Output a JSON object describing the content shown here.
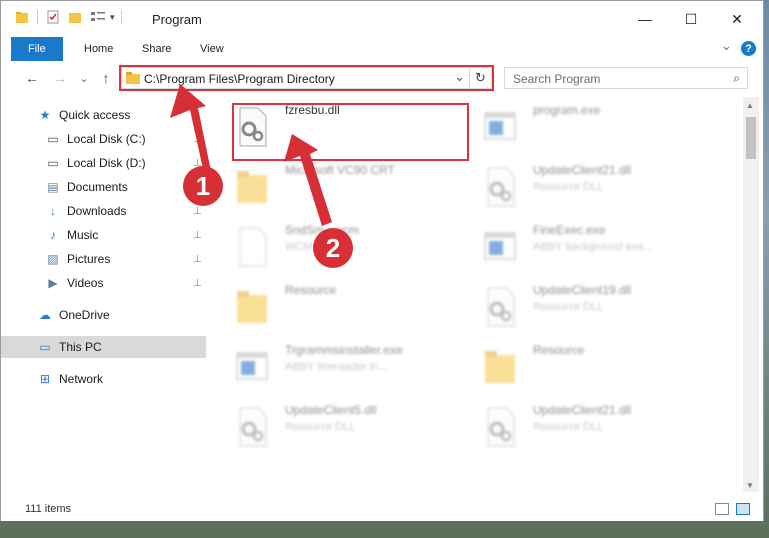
{
  "window": {
    "title": "Program",
    "controls": {
      "minimize": "—",
      "maximize": "☐",
      "close": "✕"
    }
  },
  "ribbon": {
    "tabs": [
      "File",
      "Home",
      "Share",
      "View"
    ],
    "collapse_glyph": "⌄",
    "help_glyph": "?"
  },
  "address": {
    "path": "C:\\Program Files\\Program Directory",
    "dropdown_glyph": "⌄",
    "refresh_glyph": "↻"
  },
  "search": {
    "placeholder": "Search Program",
    "icon_glyph": "⌕"
  },
  "nav": {
    "back": "←",
    "forward": "→",
    "recent": "⌄",
    "up": "↑"
  },
  "sidebar": {
    "items": [
      {
        "label": "Quick access",
        "icon": "star-icon",
        "glyph": "★",
        "color": "#2b7bd3",
        "pinned": false
      },
      {
        "label": "Local Disk (C:)",
        "icon": "drive-icon",
        "glyph": "▭",
        "color": "#555",
        "pinned": true
      },
      {
        "label": "Local Disk (D:)",
        "icon": "drive-icon",
        "glyph": "▭",
        "color": "#555",
        "pinned": true
      },
      {
        "label": "Documents",
        "icon": "document-icon",
        "glyph": "▤",
        "color": "#5a7ea6",
        "pinned": true
      },
      {
        "label": "Downloads",
        "icon": "download-icon",
        "glyph": "↓",
        "color": "#2b7bd3",
        "pinned": true
      },
      {
        "label": "Music",
        "icon": "music-icon",
        "glyph": "♪",
        "color": "#2b7bd3",
        "pinned": true
      },
      {
        "label": "Pictures",
        "icon": "pictures-icon",
        "glyph": "▨",
        "color": "#5a7ea6",
        "pinned": true
      },
      {
        "label": "Videos",
        "icon": "video-icon",
        "glyph": "▶",
        "color": "#5a7ea6",
        "pinned": true
      },
      {
        "label": "OneDrive",
        "icon": "cloud-icon",
        "glyph": "☁",
        "color": "#2b7bd3",
        "pinned": false
      },
      {
        "label": "This PC",
        "icon": "computer-icon",
        "glyph": "▭",
        "color": "#2b7bd3",
        "pinned": false
      },
      {
        "label": "Network",
        "icon": "network-icon",
        "glyph": "⊞",
        "color": "#2b7bd3",
        "pinned": false
      }
    ],
    "pin_glyph": "⊥",
    "selected": "This PC"
  },
  "files": [
    {
      "name": "fzresbu.dll",
      "sub": "",
      "icon": "dll-icon",
      "highlighted": true
    },
    {
      "name": "program.exe",
      "sub": "",
      "icon": "exe-icon",
      "highlighted": false
    },
    {
      "name": "Microsoft VC90 CRT",
      "sub": "",
      "icon": "folder-icon",
      "highlighted": false
    },
    {
      "name": "UpdateClient21.dll",
      "sub": "Resource DLL",
      "icon": "dll-icon",
      "highlighted": false
    },
    {
      "name": "SndSm...wcm",
      "sub": "WCM File",
      "icon": "blank-file-icon",
      "highlighted": false
    },
    {
      "name": "FineExec.exe",
      "sub": "ABBY background exe...",
      "icon": "exe-icon",
      "highlighted": false
    },
    {
      "name": "Resource",
      "sub": "",
      "icon": "folder-icon",
      "highlighted": false
    },
    {
      "name": "UpdateClient19.dll",
      "sub": "Resource DLL",
      "icon": "dll-icon",
      "highlighted": false
    },
    {
      "name": "Trgrammsinstaller.exe",
      "sub": "ABBY fineraader ln...",
      "icon": "exe-icon",
      "highlighted": false
    },
    {
      "name": "Resource",
      "sub": "",
      "icon": "folder-icon",
      "highlighted": false
    },
    {
      "name": "UpdateClient5.dll",
      "sub": "Resource DLL",
      "icon": "dll-icon",
      "highlighted": false
    },
    {
      "name": "UpdateClient21.dll",
      "sub": "Resource DLL",
      "icon": "dll-icon",
      "highlighted": false
    }
  ],
  "callouts": [
    {
      "number": "1",
      "color": "#d72f36"
    },
    {
      "number": "2",
      "color": "#d72f36"
    }
  ],
  "status": {
    "items_count": "111 items"
  },
  "colors": {
    "accent": "#1979ca",
    "highlight": "#d9333f",
    "selected": "#d9d9d9"
  }
}
